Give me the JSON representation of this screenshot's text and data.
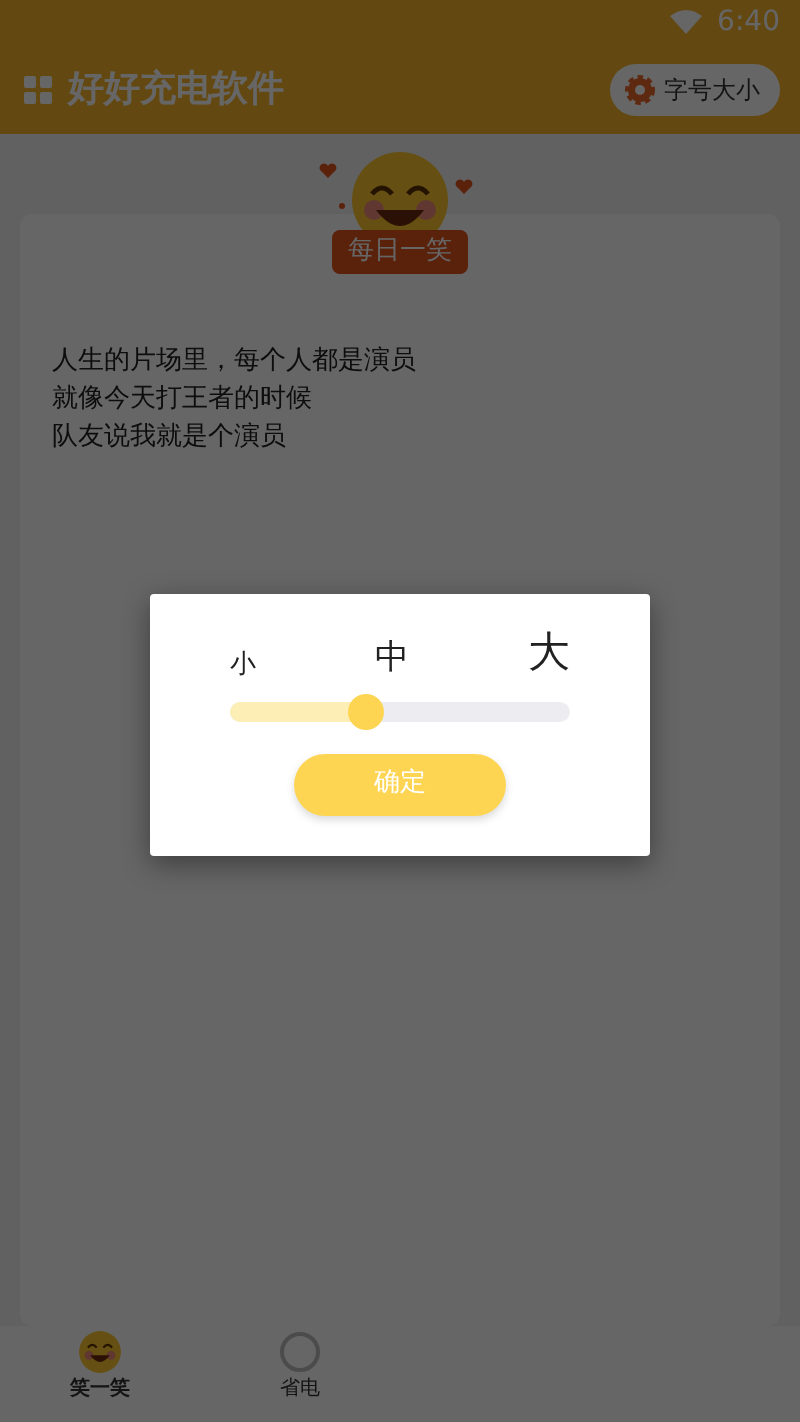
{
  "status_bar": {
    "time": "6:40"
  },
  "app_bar": {
    "title": "好好充电软件",
    "font_button": "字号大小"
  },
  "daily_joke": {
    "badge": "每日一笑",
    "lines": [
      "人生的片场里，每个人都是演员",
      "就像今天打王者的时候",
      "队友说我就是个演员"
    ]
  },
  "font_dialog": {
    "sizes": [
      "小",
      "中",
      "大"
    ],
    "slider": {
      "level": 0.4
    },
    "confirm": "确定"
  },
  "bottom_nav": [
    {
      "label": "笑一笑",
      "kind": "smile",
      "selected": true
    },
    {
      "label": "省电",
      "kind": "power",
      "selected": false
    }
  ]
}
